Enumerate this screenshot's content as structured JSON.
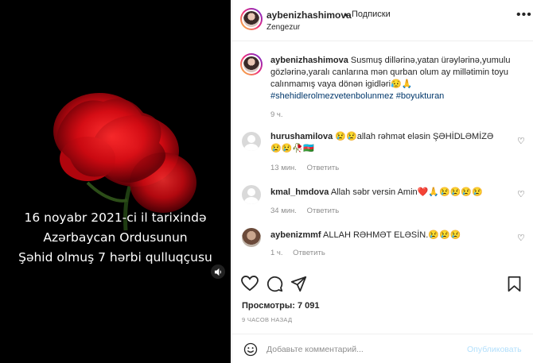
{
  "media": {
    "overlay_lines": [
      "16 noyabr 2021-ci il tarixində",
      "Azərbaycan Ordusunun",
      "Şəhid olmuş 7 hərbi qulluqçusu"
    ],
    "sound_icon": "speaker-icon"
  },
  "header": {
    "username": "aybenizhashimova",
    "separator": "•",
    "follow_label": "Подписки",
    "location": "Zengezur",
    "more_icon": "more-icon"
  },
  "caption": {
    "username": "aybenizhashimova",
    "text": "Susmuş dillərinə,yatan ürəylərinə,yumulu gözlərinə,yaralı canlarına mən qurban olum ay millətimin toyu calınmamış vaya dönən igidləri😥🙏",
    "hashtags": "#shehidlerolmezvetenbolunmez #boyukturan",
    "time": "9 ч."
  },
  "comments": [
    {
      "username": "hurushamilova",
      "text": "😢😢allah rəhmət eləsin ŞƏHİDLƏMİZƏ😢😢🥀🇦🇿",
      "time": "13 мин.",
      "reply": "Ответить"
    },
    {
      "username": "kmal_hmdova",
      "text": "Allah səbr versin Amin❤️🙏😢😢😢😢",
      "time": "34 мин.",
      "reply": "Ответить"
    },
    {
      "username": "aybenizmmf",
      "text": "ALLAH RƏHMƏT ELƏSİN.😢😢😢",
      "time": "1 ч.",
      "reply": "Ответить"
    }
  ],
  "actions": {
    "like_icon": "heart-icon",
    "comment_icon": "comment-icon",
    "share_icon": "share-icon",
    "save_icon": "bookmark-icon"
  },
  "stats": {
    "views_label": "Просмотры:",
    "views_count": "7 091",
    "posted_ago": "9 ЧАСОВ НАЗАД"
  },
  "add_comment": {
    "placeholder": "Добавьте комментарий...",
    "post_label": "Опубликовать"
  },
  "colors": {
    "link": "#00376b",
    "muted": "#8e8e8e",
    "post_disabled": "#b2dffc"
  }
}
